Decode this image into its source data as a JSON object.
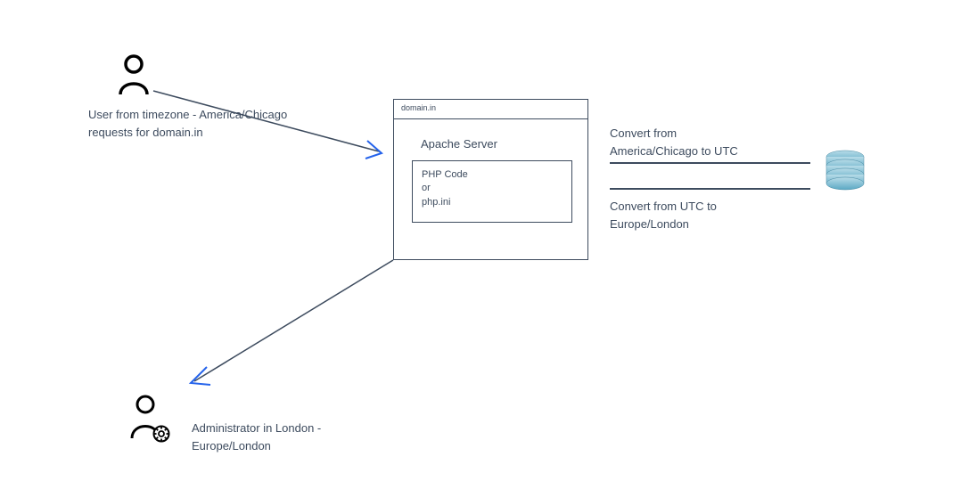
{
  "user": {
    "label": "User from timezone - America/Chicago\nrequests for domain.in"
  },
  "admin": {
    "label": "Administrator in London -\nEurope/London"
  },
  "server": {
    "titlebar": "domain.in",
    "label": "Apache Server",
    "inner": "PHP Code\nor\nphp.ini"
  },
  "convert1": {
    "label": "Convert from\nAmerica/Chicago to UTC"
  },
  "convert2": {
    "label": "Convert from UTC to\nEurope/London"
  }
}
